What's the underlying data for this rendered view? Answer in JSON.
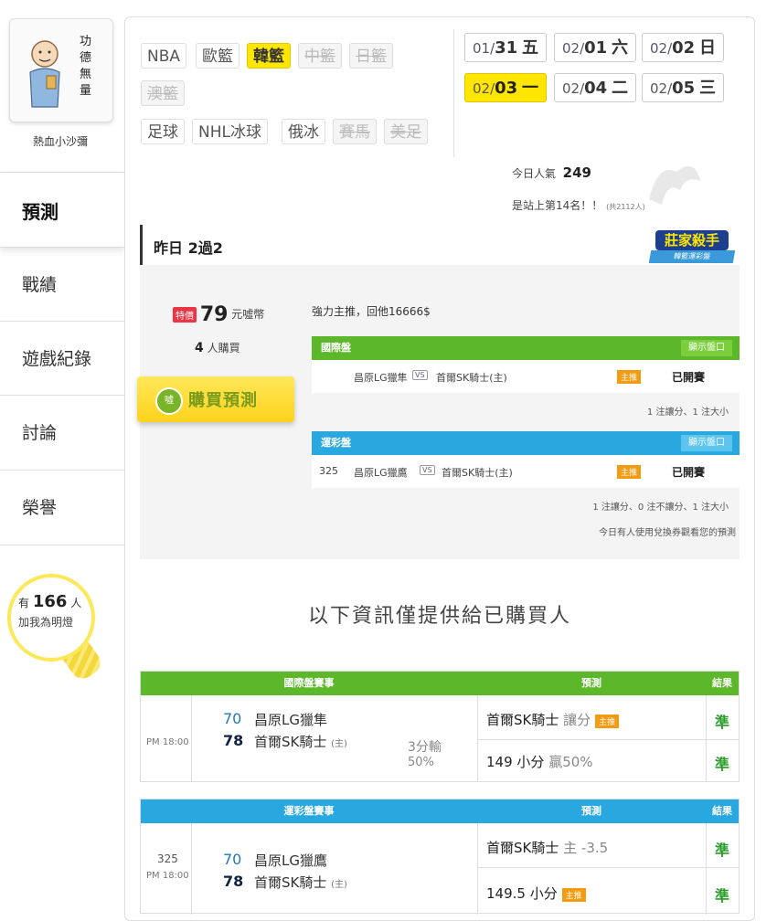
{
  "sidebar": {
    "avatar_text": "功德無量",
    "username": "熱血小沙彌",
    "nav": [
      "預測",
      "戰績",
      "遊戲紀錄",
      "討論",
      "榮譽"
    ],
    "fans_prefix": "有",
    "fans_count": "166",
    "fans_suffix": "人",
    "fans_caption": "加我為明燈"
  },
  "leagues": {
    "row1": [
      "NBA",
      "歐籃",
      "韓籃",
      "中籃",
      "日籃"
    ],
    "row2": [
      "澳籃"
    ],
    "row3": [
      "足球",
      "NHL冰球",
      "俄冰",
      "賽馬",
      "美足"
    ],
    "selected": "韓籃",
    "disabled": [
      "中籃",
      "日籃",
      "澳籃",
      "賽馬",
      "美足"
    ]
  },
  "dates": [
    {
      "month": "01/",
      "day": "31",
      "weekday": "五"
    },
    {
      "month": "02/",
      "day": "01",
      "weekday": "六"
    },
    {
      "month": "02/",
      "day": "02",
      "weekday": "日"
    },
    {
      "month": "02/",
      "day": "03",
      "weekday": "一",
      "selected": true
    },
    {
      "month": "02/",
      "day": "04",
      "weekday": "二"
    },
    {
      "month": "02/",
      "day": "05",
      "weekday": "三"
    }
  ],
  "popularity": {
    "label": "今日人氣",
    "value": "249",
    "rank_text": "是站上第14名！！",
    "total": "(共2112人)"
  },
  "yesterday": {
    "title": "昨日 2過2",
    "badge_line1": "莊家殺手",
    "badge_line2": "韓籃運彩盤",
    "price_tag": "特價",
    "price": "79",
    "price_unit": "元噓幣",
    "buyers_count": "4",
    "buyers_unit": "人購買",
    "buy_button": "購買預測",
    "buy_icon": "噓",
    "headline": "強力主推，回他16666$",
    "intl": {
      "title": "國際盤",
      "show_button": "顯示盤口",
      "match_away": "昌原LG獵隼",
      "match_home": "首爾SK騎士(主)",
      "vs": "VS",
      "tag": "主推",
      "status": "已開賽",
      "note": "1 注讓分、1 注大小"
    },
    "sport": {
      "title": "運彩盤",
      "show_button": "顯示盤口",
      "code": "325",
      "match_away": "昌原LG獵鷹",
      "match_home": "首爾SK騎士(主)",
      "vs": "VS",
      "tag": "主推",
      "status": "已開賽",
      "note": "1 注讓分、0 注不讓分、1 注大小",
      "note2": "今日有人使用兌換券觀看您的預測"
    }
  },
  "info_title": "以下資訊僅提供給已購買人",
  "intl_table": {
    "headers": [
      "國際盤賽事",
      "預測",
      "結果"
    ],
    "time": "PM 18:00",
    "away_score": "70",
    "away_team": "昌原LG獵隼",
    "home_score": "78",
    "home_team": "首爾SK騎士",
    "home_mark": "(主)",
    "margin": "3分輸",
    "margin_pct": "50%",
    "pred1_team": "首爾SK騎士",
    "pred1_type": "讓分",
    "pred1_tag": "主推",
    "pred1_result": "準",
    "pred2_value": "149 小分",
    "pred2_note": "贏50%",
    "pred2_result": "準"
  },
  "sport_table": {
    "headers": [
      "運彩盤賽事",
      "預測",
      "結果"
    ],
    "code": "325",
    "time": "PM 18:00",
    "away_score": "70",
    "away_team": "昌原LG獵鷹",
    "home_score": "78",
    "home_team": "首爾SK騎士",
    "home_mark": "(主)",
    "pred1_team": "首爾SK騎士",
    "pred1_line": "主 -3.5",
    "pred1_result": "準",
    "pred2_value": "149.5 小分",
    "pred2_tag": "主推",
    "pred2_result": "準"
  },
  "colors": {
    "green": "#5cb82a",
    "blue": "#29a8e0",
    "yellow": "#ffe600"
  }
}
